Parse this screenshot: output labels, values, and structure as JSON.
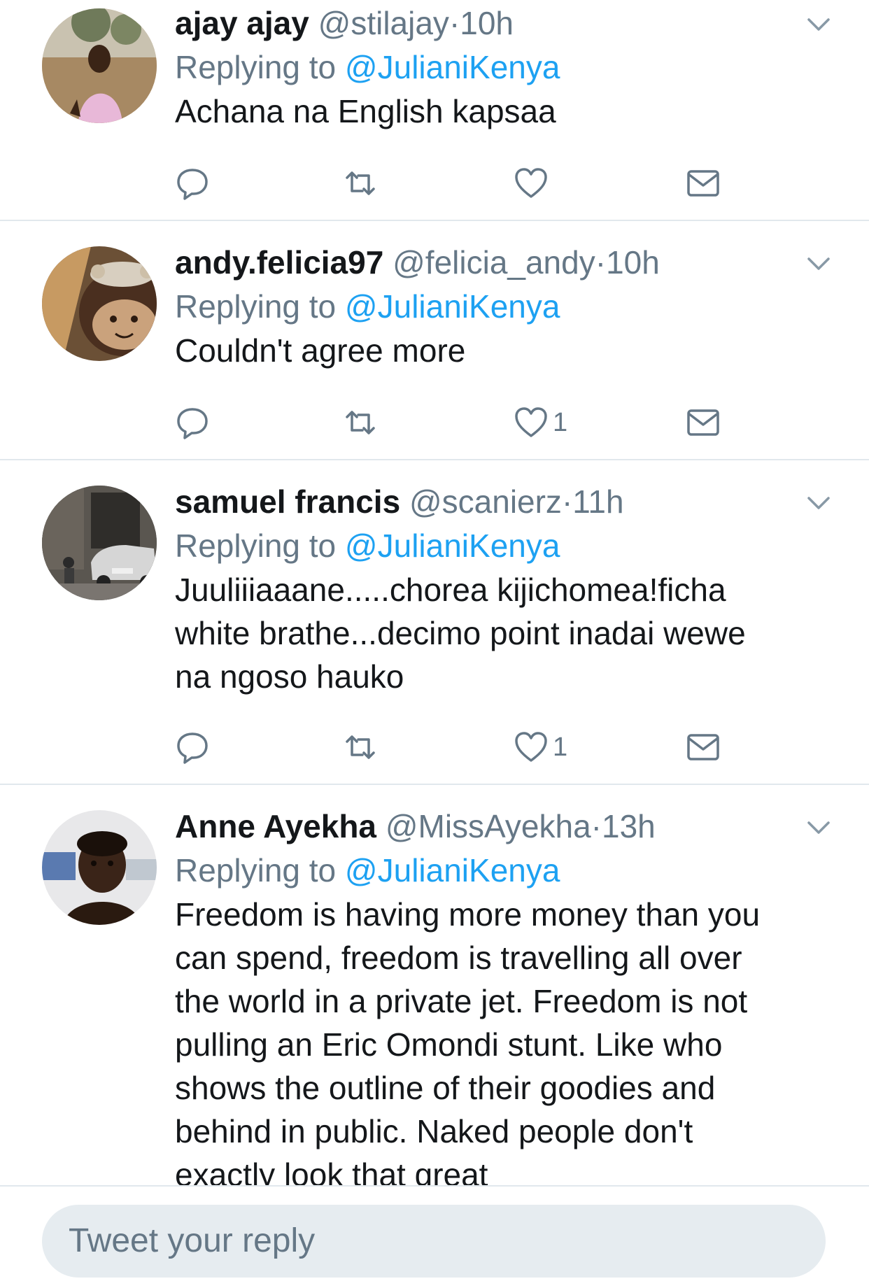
{
  "tweets": [
    {
      "name": "ajay ajay",
      "handle": "@stilajay",
      "separator": "·",
      "time": "10h",
      "replying_prefix": "Replying to ",
      "replying_to": "@JulianiKenya",
      "text_lines": [
        "Achana na English kapsaa"
      ],
      "like_count": ""
    },
    {
      "name": "andy.felicia97",
      "handle": "@felicia_andy",
      "separator": "·",
      "time": "10h",
      "replying_prefix": "Replying to ",
      "replying_to": "@JulianiKenya",
      "text_lines": [
        "Couldn't agree more"
      ],
      "like_count": "1"
    },
    {
      "name": "samuel francis",
      "handle": "@scanierz",
      "separator": "·",
      "time": "11h",
      "replying_prefix": "Replying to ",
      "replying_to": "@JulianiKenya",
      "text_lines": [
        "Juuliiiaaane.....chorea kijichomea!ficha",
        "white brathe...decimo point inadai wewe",
        "na ngoso hauko"
      ],
      "like_count": "1"
    },
    {
      "name": "Anne Ayekha",
      "handle": "@MissAyekha",
      "separator": "·",
      "time": "13h",
      "replying_prefix": "Replying to ",
      "replying_to": "@JulianiKenya",
      "text_lines": [
        "Freedom is having more money than you",
        "can spend, freedom is travelling all over",
        "the world in a private jet. Freedom is not",
        "pulling an Eric Omondi stunt. Like who",
        "shows the outline of their goodies and",
        "behind in public. Naked people don't",
        "exactly look that great"
      ],
      "like_count": ""
    }
  ],
  "icons": [
    "reply-icon",
    "retweet-icon",
    "like-icon",
    "share-mail-icon",
    "chevron-down-icon"
  ],
  "reply_bar": {
    "placeholder": "Tweet your reply"
  },
  "colors": {
    "link": "#1da1f2",
    "muted": "#657786",
    "divider": "#e1e8ed",
    "input_bg": "#e6ecf0"
  }
}
